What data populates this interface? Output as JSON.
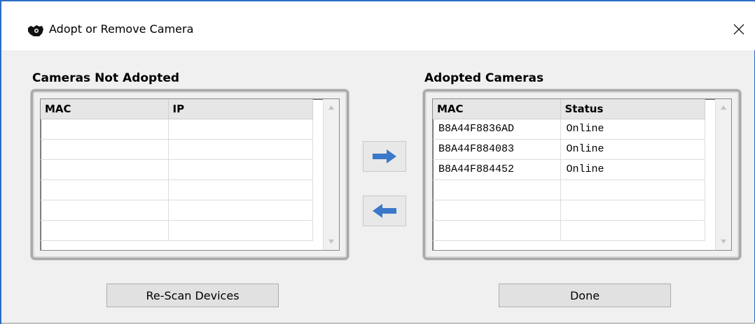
{
  "window": {
    "title": "Adopt or Remove Camera",
    "title_icon": "camera-hand-icon",
    "close_icon": "close-icon",
    "close_symbol": "✕"
  },
  "not_adopted": {
    "title": "Cameras Not Adopted",
    "columns": [
      "MAC",
      "IP"
    ],
    "rows": [
      [
        "",
        ""
      ],
      [
        "",
        ""
      ],
      [
        "",
        ""
      ],
      [
        "",
        ""
      ],
      [
        "",
        ""
      ],
      [
        "",
        ""
      ]
    ]
  },
  "adopted": {
    "title": "Adopted Cameras",
    "columns": [
      "MAC",
      "Status"
    ],
    "rows": [
      [
        "B8A44F8836AD",
        "Online"
      ],
      [
        "B8A44F884083",
        "Online"
      ],
      [
        "B8A44F884452",
        "Online"
      ],
      [
        "",
        ""
      ],
      [
        "",
        ""
      ],
      [
        "",
        ""
      ]
    ]
  },
  "transfer": {
    "adopt_icon": "arrow-right-icon",
    "remove_icon": "arrow-left-icon",
    "arrow_color": "#3a78c9"
  },
  "buttons": {
    "rescan": "Re-Scan Devices",
    "done": "Done"
  },
  "colors": {
    "accent_border": "#2b6cc4"
  }
}
